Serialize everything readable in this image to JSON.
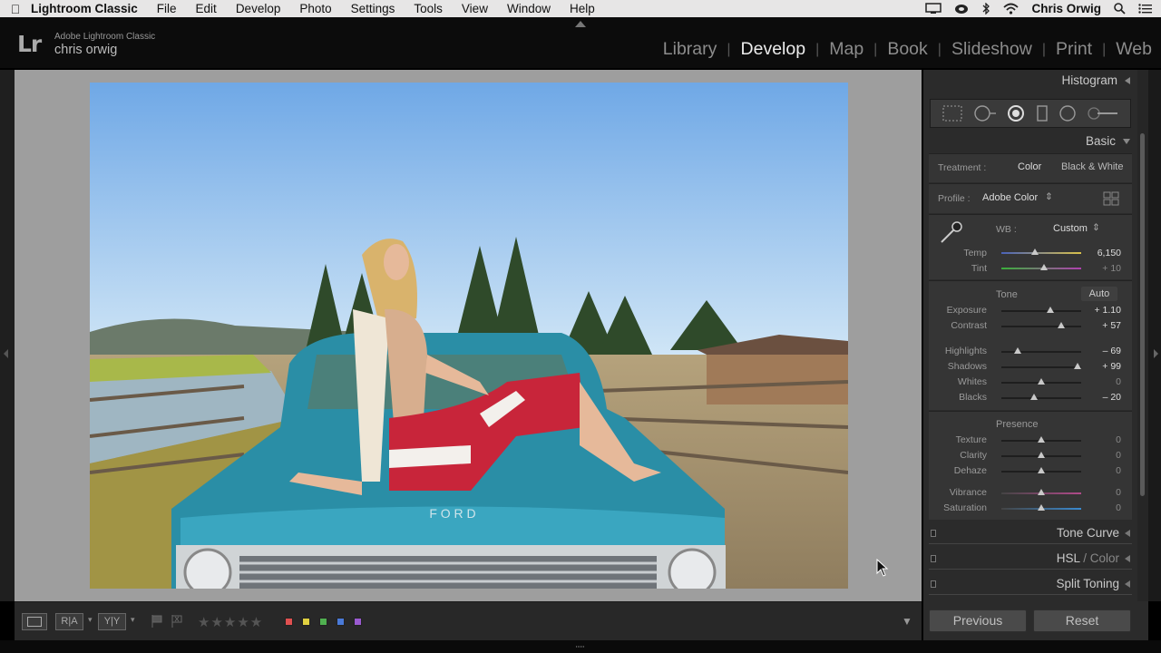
{
  "menubar": {
    "app": "Lightroom Classic",
    "items": [
      "File",
      "Edit",
      "Develop",
      "Photo",
      "Settings",
      "Tools",
      "View",
      "Window",
      "Help"
    ],
    "user": "Chris Orwig"
  },
  "identity": {
    "logo": "Lr",
    "product": "Adobe Lightroom Classic",
    "name": "chris orwig"
  },
  "modules": [
    "Library",
    "Develop",
    "Map",
    "Book",
    "Slideshow",
    "Print",
    "Web"
  ],
  "active_module": "Develop",
  "panels": {
    "histogram": "Histogram",
    "basic": "Basic",
    "treatment": {
      "label": "Treatment :",
      "color": "Color",
      "bw": "Black & White"
    },
    "profile": {
      "label": "Profile :",
      "value": "Adobe Color"
    },
    "wb": {
      "label": "WB :",
      "value": "Custom"
    },
    "temp": {
      "label": "Temp",
      "value": "6,150",
      "pos": 0.42
    },
    "tint": {
      "label": "Tint",
      "value": "+ 10",
      "pos": 0.53
    },
    "tone": {
      "label": "Tone",
      "auto": "Auto"
    },
    "exposure": {
      "label": "Exposure",
      "value": "+ 1.10",
      "pos": 0.61
    },
    "contrast": {
      "label": "Contrast",
      "value": "+ 57",
      "pos": 0.75
    },
    "highlights": {
      "label": "Highlights",
      "value": "– 69",
      "pos": 0.2
    },
    "shadows": {
      "label": "Shadows",
      "value": "+ 99",
      "pos": 0.95
    },
    "whites": {
      "label": "Whites",
      "value": "0",
      "pos": 0.5
    },
    "blacks": {
      "label": "Blacks",
      "value": "– 20",
      "pos": 0.41
    },
    "presence": "Presence",
    "texture": {
      "label": "Texture",
      "value": "0",
      "pos": 0.5
    },
    "clarity": {
      "label": "Clarity",
      "value": "0",
      "pos": 0.5
    },
    "dehaze": {
      "label": "Dehaze",
      "value": "0",
      "pos": 0.5
    },
    "vibrance": {
      "label": "Vibrance",
      "value": "0",
      "pos": 0.5
    },
    "saturation": {
      "label": "Saturation",
      "value": "0",
      "pos": 0.5
    },
    "tone_curve": "Tone Curve",
    "hsl": "HSL",
    "color": "Color",
    "split_toning": "Split Toning"
  },
  "buttons": {
    "previous": "Previous",
    "reset": "Reset"
  },
  "toolbar": {
    "compare_ab": "R|A",
    "yy": "Y|Y",
    "stars": "★★★★★"
  },
  "photo": {
    "hood_text": "F  O  R  D"
  },
  "color_labels": [
    "#e05050",
    "#e0d040",
    "#50b050",
    "#4a7ad8",
    "#9a5ad0"
  ]
}
